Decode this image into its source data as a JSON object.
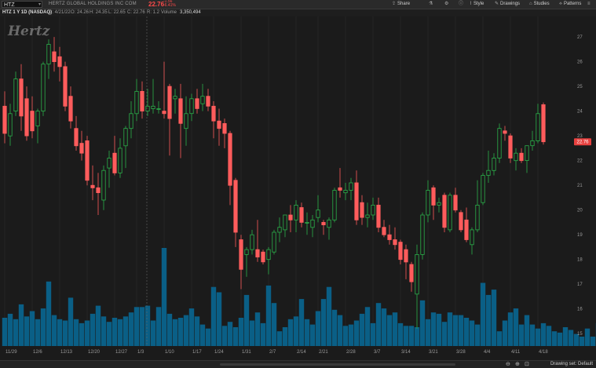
{
  "header": {
    "symbol": "HTZ",
    "company": "HERTZ GLOBAL HOLDINGS INC COM",
    "last_price": "22.76",
    "change": "-1.56",
    "change_pct": "-6.41%",
    "tools": [
      "Share",
      "Style",
      "Drawings",
      "Studies",
      "Patterns"
    ]
  },
  "info": {
    "title": "HTZ 1 Y 1D (NASDAQ)",
    "date": "D: 4/21/22",
    "open": "O: 24.26",
    "high": "H: 24.35",
    "low": "L: 22.65",
    "close": "C: 22.76",
    "range": "R: 1.2",
    "volume_label": "Volume",
    "volume": "3,350,494"
  },
  "watermark": "Hertz",
  "footer": {
    "drawing_set": "Drawing set: Default"
  },
  "colors": {
    "up": "#2bb14a",
    "down": "#ff5c5c",
    "volume": "#0a5f86",
    "price_tag": "#e8413f",
    "background": "#1b1b1b"
  },
  "chart_data": {
    "type": "candlestick",
    "symbol": "HTZ",
    "interval": "1D",
    "ylim": [
      14.5,
      27.7
    ],
    "y_ticks": [
      15,
      16,
      17,
      18,
      19,
      20,
      21,
      22,
      23,
      24,
      25,
      26,
      27
    ],
    "last_price_tag": "22.76",
    "x_tick_labels": [
      {
        "label": "11/29",
        "index": 0
      },
      {
        "label": "12/6",
        "index": 5
      },
      {
        "label": "12/13",
        "index": 10
      },
      {
        "label": "12/20",
        "index": 15
      },
      {
        "label": "12/27",
        "index": 20
      },
      {
        "label": "1/3",
        "index": 24
      },
      {
        "label": "1/10",
        "index": 29
      },
      {
        "label": "1/17",
        "index": 34
      },
      {
        "label": "1/24",
        "index": 38
      },
      {
        "label": "1/31",
        "index": 43
      },
      {
        "label": "2/7",
        "index": 48
      },
      {
        "label": "2/14",
        "index": 53
      },
      {
        "label": "2/21",
        "index": 57
      },
      {
        "label": "2/28",
        "index": 62
      },
      {
        "label": "3/7",
        "index": 67
      },
      {
        "label": "3/14",
        "index": 72
      },
      {
        "label": "3/21",
        "index": 77
      },
      {
        "label": "3/28",
        "index": 82
      },
      {
        "label": "4/4",
        "index": 87
      },
      {
        "label": "4/11",
        "index": 92
      },
      {
        "label": "4/18",
        "index": 97
      }
    ],
    "candles": [
      {
        "o": 24.2,
        "h": 24.8,
        "l": 22.7,
        "c": 23.1
      },
      {
        "o": 23.0,
        "h": 24.3,
        "l": 22.6,
        "c": 23.9
      },
      {
        "o": 24.0,
        "h": 25.6,
        "l": 23.8,
        "c": 25.3
      },
      {
        "o": 25.3,
        "h": 25.9,
        "l": 23.2,
        "c": 23.8
      },
      {
        "o": 24.5,
        "h": 25.0,
        "l": 22.8,
        "c": 23.0
      },
      {
        "o": 24.0,
        "h": 24.6,
        "l": 22.9,
        "c": 23.2
      },
      {
        "o": 23.4,
        "h": 24.1,
        "l": 22.7,
        "c": 24.0
      },
      {
        "o": 24.0,
        "h": 26.0,
        "l": 23.8,
        "c": 25.9
      },
      {
        "o": 25.9,
        "h": 26.9,
        "l": 25.3,
        "c": 26.7
      },
      {
        "o": 26.4,
        "h": 27.0,
        "l": 25.6,
        "c": 26.0
      },
      {
        "o": 26.2,
        "h": 26.6,
        "l": 25.2,
        "c": 25.8
      },
      {
        "o": 25.8,
        "h": 26.0,
        "l": 24.0,
        "c": 24.2
      },
      {
        "o": 24.6,
        "h": 25.0,
        "l": 23.3,
        "c": 23.6
      },
      {
        "o": 23.3,
        "h": 23.8,
        "l": 22.4,
        "c": 22.6
      },
      {
        "o": 22.7,
        "h": 23.2,
        "l": 22.0,
        "c": 22.3
      },
      {
        "o": 22.8,
        "h": 23.0,
        "l": 21.0,
        "c": 21.2
      },
      {
        "o": 21.0,
        "h": 21.8,
        "l": 20.4,
        "c": 20.9
      },
      {
        "o": 20.9,
        "h": 21.5,
        "l": 19.8,
        "c": 20.7
      },
      {
        "o": 20.4,
        "h": 21.8,
        "l": 20.0,
        "c": 21.6
      },
      {
        "o": 21.7,
        "h": 22.4,
        "l": 20.9,
        "c": 22.1
      },
      {
        "o": 22.3,
        "h": 23.0,
        "l": 21.4,
        "c": 21.5
      },
      {
        "o": 21.5,
        "h": 22.9,
        "l": 21.3,
        "c": 22.5
      },
      {
        "o": 22.6,
        "h": 23.4,
        "l": 21.7,
        "c": 23.3
      },
      {
        "o": 23.3,
        "h": 24.4,
        "l": 22.9,
        "c": 23.9
      },
      {
        "o": 23.9,
        "h": 25.3,
        "l": 23.6,
        "c": 24.8
      },
      {
        "o": 24.8,
        "h": 25.2,
        "l": 23.7,
        "c": 24.0
      },
      {
        "o": 24.0,
        "h": 24.9,
        "l": 23.8,
        "c": 24.2
      },
      {
        "o": 24.1,
        "h": 25.3,
        "l": 23.9,
        "c": 24.2
      },
      {
        "o": 24.1,
        "h": 24.4,
        "l": 23.9,
        "c": 24.1
      },
      {
        "o": 24.0,
        "h": 26.0,
        "l": 23.7,
        "c": 23.9
      },
      {
        "o": 25.0,
        "h": 25.1,
        "l": 22.2,
        "c": 23.7
      },
      {
        "o": 24.5,
        "h": 24.9,
        "l": 23.9,
        "c": 24.6
      },
      {
        "o": 24.5,
        "h": 25.1,
        "l": 22.1,
        "c": 23.5
      },
      {
        "o": 23.3,
        "h": 24.6,
        "l": 22.6,
        "c": 23.9
      },
      {
        "o": 23.9,
        "h": 24.7,
        "l": 23.6,
        "c": 24.5
      },
      {
        "o": 24.5,
        "h": 24.9,
        "l": 23.9,
        "c": 24.1
      },
      {
        "o": 24.3,
        "h": 25.1,
        "l": 24.0,
        "c": 24.6
      },
      {
        "o": 24.6,
        "h": 24.9,
        "l": 24.0,
        "c": 24.2
      },
      {
        "o": 24.2,
        "h": 24.4,
        "l": 22.9,
        "c": 23.6
      },
      {
        "o": 23.6,
        "h": 24.1,
        "l": 22.6,
        "c": 23.3
      },
      {
        "o": 23.5,
        "h": 23.7,
        "l": 22.5,
        "c": 23.1
      },
      {
        "o": 23.1,
        "h": 23.2,
        "l": 20.2,
        "c": 21.0
      },
      {
        "o": 21.2,
        "h": 21.3,
        "l": 18.5,
        "c": 19.1
      },
      {
        "o": 18.8,
        "h": 19.0,
        "l": 16.8,
        "c": 17.6
      },
      {
        "o": 18.2,
        "h": 18.5,
        "l": 17.3,
        "c": 18.4
      },
      {
        "o": 18.4,
        "h": 19.2,
        "l": 18.2,
        "c": 19.0
      },
      {
        "o": 18.4,
        "h": 19.6,
        "l": 17.9,
        "c": 18.1
      },
      {
        "o": 18.3,
        "h": 18.4,
        "l": 17.8,
        "c": 17.9
      },
      {
        "o": 18.0,
        "h": 18.5,
        "l": 17.4,
        "c": 18.4
      },
      {
        "o": 18.3,
        "h": 19.2,
        "l": 18.2,
        "c": 19.1
      },
      {
        "o": 19.1,
        "h": 19.7,
        "l": 18.7,
        "c": 19.3
      },
      {
        "o": 19.2,
        "h": 19.8,
        "l": 18.9,
        "c": 19.8
      },
      {
        "o": 19.8,
        "h": 20.2,
        "l": 19.1,
        "c": 19.6
      },
      {
        "o": 19.6,
        "h": 20.4,
        "l": 19.1,
        "c": 20.2
      },
      {
        "o": 20.1,
        "h": 20.3,
        "l": 19.3,
        "c": 19.5
      },
      {
        "o": 19.5,
        "h": 19.9,
        "l": 19.0,
        "c": 19.5
      },
      {
        "o": 19.3,
        "h": 19.8,
        "l": 18.9,
        "c": 19.6
      },
      {
        "o": 19.7,
        "h": 20.6,
        "l": 19.5,
        "c": 20.0
      },
      {
        "o": 19.5,
        "h": 19.6,
        "l": 19.0,
        "c": 19.4
      },
      {
        "o": 19.3,
        "h": 19.7,
        "l": 18.8,
        "c": 19.6
      },
      {
        "o": 19.6,
        "h": 20.9,
        "l": 19.5,
        "c": 20.8
      },
      {
        "o": 20.9,
        "h": 21.7,
        "l": 20.5,
        "c": 20.8
      },
      {
        "o": 20.7,
        "h": 21.1,
        "l": 20.4,
        "c": 20.8
      },
      {
        "o": 20.8,
        "h": 21.3,
        "l": 20.4,
        "c": 21.1
      },
      {
        "o": 21.1,
        "h": 21.6,
        "l": 19.4,
        "c": 19.6
      },
      {
        "o": 20.3,
        "h": 20.6,
        "l": 19.4,
        "c": 19.7
      },
      {
        "o": 19.7,
        "h": 20.3,
        "l": 19.3,
        "c": 19.8
      },
      {
        "o": 19.8,
        "h": 20.5,
        "l": 19.6,
        "c": 20.2
      },
      {
        "o": 20.2,
        "h": 20.5,
        "l": 19.1,
        "c": 19.3
      },
      {
        "o": 19.3,
        "h": 19.6,
        "l": 18.9,
        "c": 19.0
      },
      {
        "o": 19.0,
        "h": 19.4,
        "l": 18.6,
        "c": 18.8
      },
      {
        "o": 18.8,
        "h": 19.3,
        "l": 18.4,
        "c": 18.6
      },
      {
        "o": 18.7,
        "h": 18.8,
        "l": 17.8,
        "c": 18.0
      },
      {
        "o": 18.4,
        "h": 18.6,
        "l": 17.2,
        "c": 17.9
      },
      {
        "o": 17.8,
        "h": 17.9,
        "l": 16.7,
        "c": 17.1
      },
      {
        "o": 16.6,
        "h": 18.6,
        "l": 15.2,
        "c": 18.2
      },
      {
        "o": 18.2,
        "h": 19.9,
        "l": 18.0,
        "c": 19.8
      },
      {
        "o": 19.8,
        "h": 21.2,
        "l": 19.5,
        "c": 20.8
      },
      {
        "o": 20.9,
        "h": 21.0,
        "l": 19.6,
        "c": 20.2
      },
      {
        "o": 20.2,
        "h": 20.5,
        "l": 19.9,
        "c": 20.3
      },
      {
        "o": 20.6,
        "h": 20.7,
        "l": 19.1,
        "c": 19.3
      },
      {
        "o": 19.2,
        "h": 20.7,
        "l": 19.1,
        "c": 20.6
      },
      {
        "o": 20.6,
        "h": 20.9,
        "l": 19.9,
        "c": 20.0
      },
      {
        "o": 19.9,
        "h": 20.0,
        "l": 19.1,
        "c": 19.2
      },
      {
        "o": 19.6,
        "h": 20.1,
        "l": 18.7,
        "c": 18.8
      },
      {
        "o": 18.6,
        "h": 19.3,
        "l": 18.2,
        "c": 19.2
      },
      {
        "o": 19.2,
        "h": 21.2,
        "l": 19.1,
        "c": 20.2
      },
      {
        "o": 20.3,
        "h": 21.5,
        "l": 20.2,
        "c": 21.4
      },
      {
        "o": 21.4,
        "h": 22.4,
        "l": 21.1,
        "c": 21.6
      },
      {
        "o": 21.6,
        "h": 22.3,
        "l": 21.4,
        "c": 22.1
      },
      {
        "o": 22.1,
        "h": 23.5,
        "l": 21.9,
        "c": 23.3
      },
      {
        "o": 23.2,
        "h": 23.4,
        "l": 22.8,
        "c": 23.1
      },
      {
        "o": 23.0,
        "h": 23.1,
        "l": 21.9,
        "c": 22.1
      },
      {
        "o": 22.0,
        "h": 22.5,
        "l": 21.6,
        "c": 22.3
      },
      {
        "o": 22.3,
        "h": 22.5,
        "l": 21.9,
        "c": 22.0
      },
      {
        "o": 22.0,
        "h": 22.6,
        "l": 21.5,
        "c": 22.6
      },
      {
        "o": 22.6,
        "h": 23.2,
        "l": 22.4,
        "c": 22.8
      },
      {
        "o": 22.8,
        "h": 24.3,
        "l": 22.7,
        "c": 23.9
      },
      {
        "o": 24.26,
        "h": 24.35,
        "l": 22.65,
        "c": 22.76
      }
    ],
    "volumes_millions": [
      2.1,
      2.4,
      2.0,
      3.1,
      2.2,
      2.6,
      2.0,
      2.8,
      4.8,
      2.3,
      2.0,
      1.9,
      3.6,
      2.0,
      1.7,
      1.9,
      2.4,
      3.0,
      2.2,
      1.8,
      2.1,
      2.0,
      2.2,
      2.5,
      2.9,
      2.9,
      3.0,
      1.9,
      2.9,
      7.3,
      2.4,
      2.0,
      2.1,
      2.3,
      2.8,
      2.2,
      1.6,
      1.3,
      4.4,
      4.0,
      1.5,
      1.8,
      1.4,
      2.1,
      3.8,
      1.9,
      2.5,
      1.7,
      4.5,
      3.2,
      1.1,
      1.4,
      2.0,
      2.2,
      3.5,
      2.0,
      1.6,
      2.6,
      3.5,
      4.4,
      2.7,
      2.3,
      1.5,
      1.6,
      1.9,
      2.4,
      2.9,
      1.7,
      3.2,
      2.8,
      2.3,
      2.5,
      1.7,
      1.5,
      1.5,
      1.4,
      3.4,
      2.0,
      2.5,
      2.4,
      1.8,
      2.5,
      2.3,
      2.3,
      2.1,
      1.9,
      1.6,
      4.7,
      3.8,
      4.2,
      1.1,
      1.9,
      2.5,
      2.8,
      1.6,
      2.3,
      1.6,
      1.3,
      1.7,
      1.5,
      1.1,
      1.0,
      1.4,
      1.2,
      0.9,
      0.7,
      1.3,
      0.7,
      1.7,
      1.6
    ],
    "volume_scale_max": 7.3
  }
}
